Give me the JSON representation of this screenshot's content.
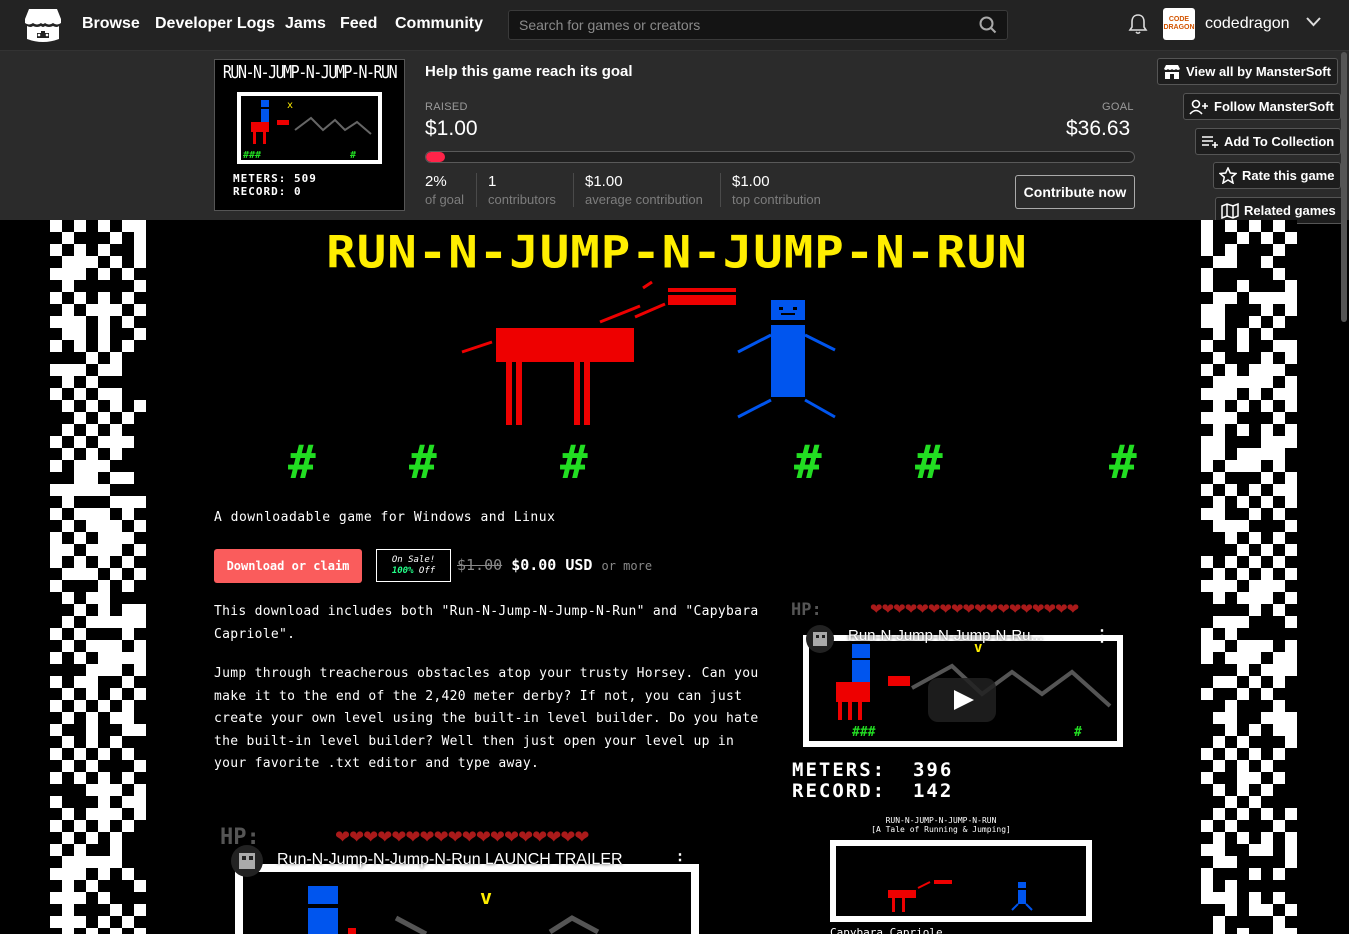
{
  "nav": {
    "items": [
      "Browse",
      "Developer Logs",
      "Jams",
      "Feed",
      "Community"
    ],
    "search_placeholder": "Search for games or creators",
    "username": "codedragon",
    "avatar_text": "CODE DRAGON"
  },
  "goal": {
    "title": "Help this game reach its goal",
    "raised_label": "RAISED",
    "raised": "$1.00",
    "goal_label": "GOAL",
    "goal": "$36.63",
    "progress": 0.027,
    "stats": [
      {
        "value": "2%",
        "label": "of goal"
      },
      {
        "value": "1",
        "label": "contributors"
      },
      {
        "value": "$1.00",
        "label": "average contribution"
      },
      {
        "value": "$1.00",
        "label": "top contribution"
      }
    ],
    "contribute_label": "Contribute now",
    "thumb_title": "RUN-N-JUMP-N-JUMP-N-RUN",
    "thumb_meters": "METERS: 509",
    "thumb_record": "RECORD: 0"
  },
  "actions": {
    "view_all": "View all by MansterSoft",
    "follow": "Follow MansterSoft",
    "add_collection": "Add To Collection",
    "rate": "Rate this game",
    "related": "Related games"
  },
  "game": {
    "title": "RUN-N-JUMP-N-JUMP-N-RUN",
    "hash": "#",
    "tagline": "A downloadable game for Windows and Linux",
    "download_label": "Download or claim",
    "sale_line1": "On Sale!",
    "sale_pct": "100%",
    "sale_off": "Off",
    "old_price": "$1.00",
    "new_price": "$0.00 USD",
    "or_more": "or more",
    "desc1": "This download includes both \"Run-N-Jump-N-Jump-N-Run\" and \"Capybara Capriole\".",
    "desc2": "Jump through treacherous obstacles atop your trusty Horsey. Can you make it to the end of the 2,420 meter derby? If not, you can just create your own level using the built-in level builder. Do you hate the built-in level builder? Well then just open your level up in your favorite .txt editor and type away.",
    "hp_label": "HP:",
    "hearts": "❤❤❤❤❤❤❤❤❤❤❤❤❤❤❤❤❤❤",
    "video1_title": "Run-N-Jump-N-Jump-N-Ru...",
    "video2_title": "Run-N-Jump-N-Jump-N-Run LAUNCH TRAILER",
    "meters": "METERS:  396",
    "record": "RECORD:  142",
    "banner_line1": "RUN-N-JUMP-N-JUMP-N-RUN",
    "banner_line2": "[A Tale of Running & Jumping]",
    "caption": "Capybara Capriole"
  },
  "colors": {
    "accent": "#fa5c5c",
    "progress": "#ff2449",
    "title_yellow": "#ffee00",
    "hash_green": "#22dd22",
    "horse_red": "#ee0000",
    "man_blue": "#0055ee"
  }
}
